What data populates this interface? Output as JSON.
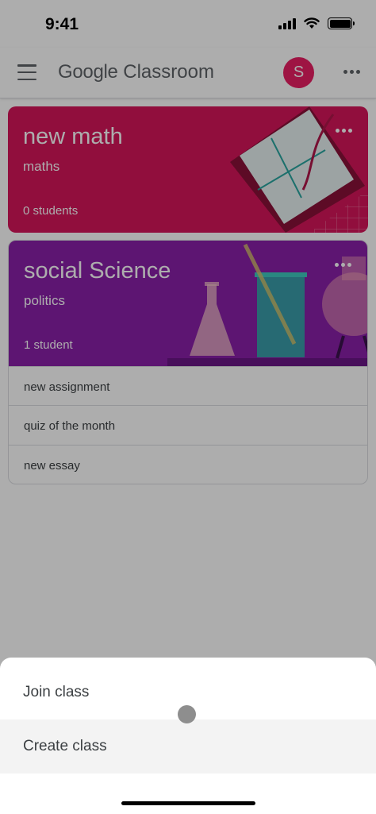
{
  "status_bar": {
    "time": "9:41"
  },
  "app_bar": {
    "brand": "Google",
    "product": "Classroom",
    "avatar_letter": "S"
  },
  "classes": [
    {
      "title": "new math",
      "section": "maths",
      "students": "0 students",
      "color": "#d6155b"
    },
    {
      "title": "social Science",
      "section": "politics",
      "students": "1 student",
      "color": "#8a1fa8",
      "assignments": [
        "new assignment",
        "quiz of the month",
        "new essay"
      ]
    }
  ],
  "sheet": {
    "join_label": "Join class",
    "create_label": "Create class"
  },
  "icons": {
    "menu": "menu-icon",
    "more": "more-vert-icon",
    "signal": "signal-icon",
    "wifi": "wifi-icon",
    "battery": "battery-icon"
  }
}
